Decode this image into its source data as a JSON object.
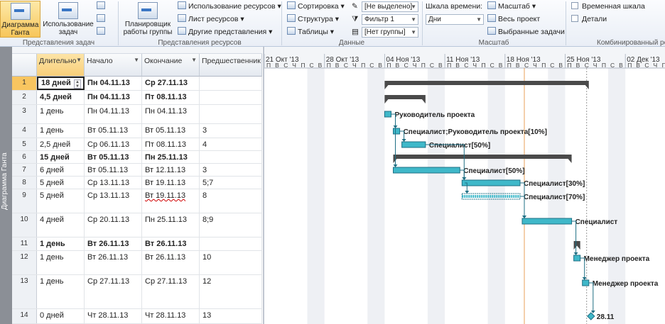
{
  "ribbon": {
    "gantt_label": "Диаграмма Ганта",
    "task_usage_label": "Использование задач",
    "task_views_group": "Представления задач",
    "team_planner_label": "Планировщик работы группы",
    "resource_usage": "Использование ресурсов",
    "resource_sheet": "Лист ресурсов",
    "other_views": "Другие представления",
    "resource_views_group": "Представления ресурсов",
    "sort": "Сортировка",
    "outline": "Структура",
    "tables": "Таблицы",
    "highlight_value": "[Не выделено]",
    "filter_value": "Фильтр 1",
    "group_value": "[Нет группы]",
    "data_group": "Данные",
    "timescale_label": "Шкала времени:",
    "timescale_value": "Дни",
    "zoom": "Масштаб",
    "entire_project": "Весь проект",
    "selected_tasks": "Выбранные задачи",
    "zoom_group": "Масштаб",
    "timeline": "Временная шкала",
    "details": "Детали",
    "split_view_group": "Комбинированный ре"
  },
  "sidebar_label": "Диаграмма Ганта",
  "columns": {
    "duration": "Длительно",
    "start": "Начало",
    "finish": "Окончание",
    "predecessors": "Предшественник"
  },
  "rows": [
    {
      "id": "1",
      "duration": "18 дней",
      "start": "Пн 04.11.13",
      "finish": "Ср 27.11.13",
      "pred": "",
      "bold": true
    },
    {
      "id": "2",
      "duration": "4,5 дней",
      "start": "Пн 04.11.13",
      "finish": "Пт 08.11.13",
      "pred": "",
      "bold": true
    },
    {
      "id": "3",
      "duration": "1 день",
      "start": "Пн 04.11.13",
      "finish": "Пн 04.11.13",
      "pred": "",
      "bold": false
    },
    {
      "id": "4",
      "duration": "1 день",
      "start": "Вт 05.11.13",
      "finish": "Вт 05.11.13",
      "pred": "3",
      "bold": false
    },
    {
      "id": "5",
      "duration": "2,5 дней",
      "start": "Ср 06.11.13",
      "finish": "Пт 08.11.13",
      "pred": "4",
      "bold": false
    },
    {
      "id": "6",
      "duration": "15 дней",
      "start": "Вт 05.11.13",
      "finish": "Пн 25.11.13",
      "pred": "",
      "bold": true
    },
    {
      "id": "7",
      "duration": "6 дней",
      "start": "Вт 05.11.13",
      "finish": "Вт 12.11.13",
      "pred": "3",
      "bold": false
    },
    {
      "id": "8",
      "duration": "5 дней",
      "start": "Ср 13.11.13",
      "finish": "Вт 19.11.13",
      "pred": "5;7",
      "bold": false
    },
    {
      "id": "9",
      "duration": "5 дней",
      "start": "Ср 13.11.13",
      "finish": "Вт 19.11.13",
      "pred": "8",
      "bold": false
    },
    {
      "id": "10",
      "duration": "4 дней",
      "start": "Ср 20.11.13",
      "finish": "Пн 25.11.13",
      "pred": "8;9",
      "bold": false
    },
    {
      "id": "11",
      "duration": "1 день",
      "start": "Вт 26.11.13",
      "finish": "Вт 26.11.13",
      "pred": "",
      "bold": true
    },
    {
      "id": "12",
      "duration": "1 день",
      "start": "Вт 26.11.13",
      "finish": "Вт 26.11.13",
      "pred": "10",
      "bold": false
    },
    {
      "id": "13",
      "duration": "1 день",
      "start": "Ср 27.11.13",
      "finish": "Ср 27.11.13",
      "pred": "12",
      "bold": false
    },
    {
      "id": "14",
      "duration": "0 дней",
      "start": "Чт 28.11.13",
      "finish": "Чт 28.11.13",
      "pred": "13",
      "bold": false
    }
  ],
  "timeline": {
    "weeks": [
      "21 Окт '13",
      "28 Окт '13",
      "04 Ноя '13",
      "11 Ноя '13",
      "18 Ноя '13",
      "25 Ноя '13",
      "02 Дек '13"
    ],
    "day_letters": [
      "П",
      "В",
      "С",
      "Ч",
      "П",
      "С",
      "В"
    ]
  },
  "gantt": {
    "tasks": [
      {
        "row": 1,
        "type": "summary",
        "start": "2013-11-04",
        "finish": "2013-11-27",
        "label": ""
      },
      {
        "row": 2,
        "type": "summary",
        "start": "2013-11-04",
        "finish": "2013-11-08",
        "label": ""
      },
      {
        "row": 3,
        "type": "task",
        "start": "2013-11-04",
        "finish": "2013-11-04",
        "label": "Руководитель проекта"
      },
      {
        "row": 4,
        "type": "task",
        "start": "2013-11-05",
        "finish": "2013-11-05",
        "label": "Специалист;Руководитель проекта[10%]"
      },
      {
        "row": 5,
        "type": "task",
        "start": "2013-11-06",
        "finish": "2013-11-08",
        "label": "Специалист[50%]"
      },
      {
        "row": 6,
        "type": "summary",
        "start": "2013-11-05",
        "finish": "2013-11-25",
        "label": ""
      },
      {
        "row": 7,
        "type": "task",
        "start": "2013-11-05",
        "finish": "2013-11-12",
        "label": "Специалист[50%]"
      },
      {
        "row": 8,
        "type": "task",
        "start": "2013-11-13",
        "finish": "2013-11-19",
        "label": "Специалист[30%]"
      },
      {
        "row": 9,
        "type": "split",
        "start": "2013-11-13",
        "finish": "2013-11-19",
        "label": "Специалист[70%]"
      },
      {
        "row": 10,
        "type": "task",
        "start": "2013-11-20",
        "finish": "2013-11-25",
        "label": "Специалист"
      },
      {
        "row": 11,
        "type": "summary",
        "start": "2013-11-26",
        "finish": "2013-11-26",
        "label": ""
      },
      {
        "row": 12,
        "type": "task",
        "start": "2013-11-26",
        "finish": "2013-11-26",
        "label": "Менеджер проекта"
      },
      {
        "row": 13,
        "type": "task",
        "start": "2013-11-27",
        "finish": "2013-11-27",
        "label": "Менеджер проекта"
      },
      {
        "row": 14,
        "type": "milestone",
        "start": "2013-11-28",
        "finish": "2013-11-28",
        "label": "28.11"
      }
    ],
    "colors": {
      "task": "#3fb8c9",
      "task_dark": "#1f6f84",
      "summary": "#4a4a4a",
      "today_line": "#e8a05a"
    }
  }
}
